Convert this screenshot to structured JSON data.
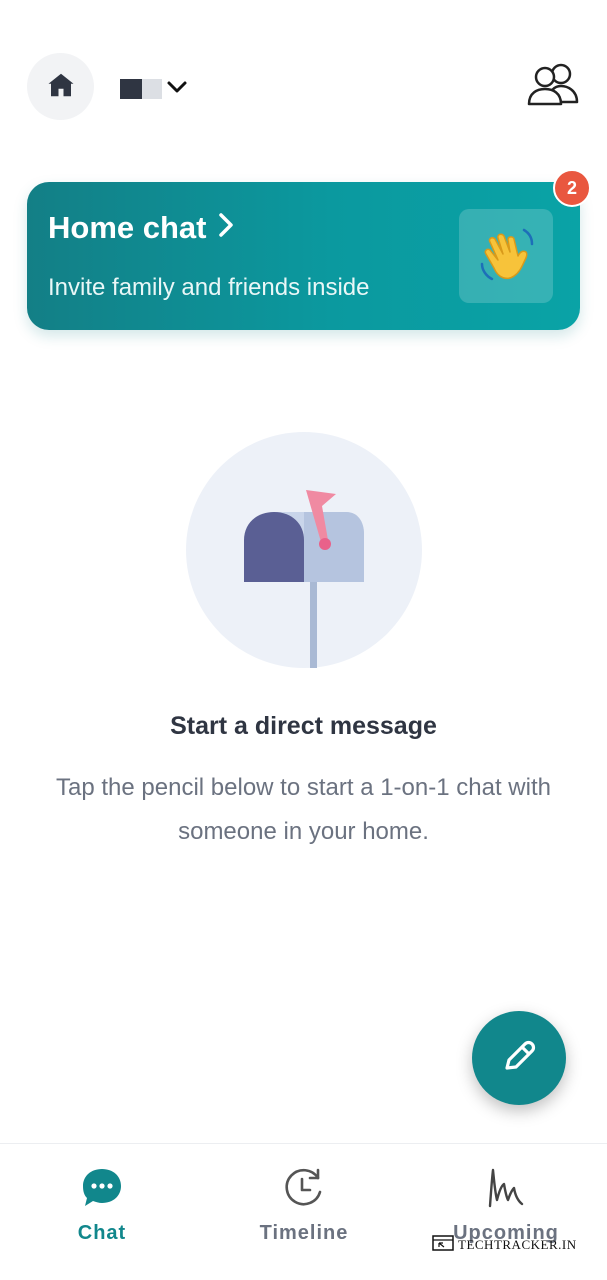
{
  "header": {
    "home_icon": "house-icon",
    "home_selector_icon": "chevron-down-icon",
    "members_icon": "people-icon"
  },
  "home_chat_card": {
    "title": "Home chat",
    "subtitle": "Invite family and friends inside",
    "icon": "waving-hand-icon",
    "badge_count": "2",
    "colors": {
      "start": "#137f86",
      "end": "#0aa3a6",
      "badge": "#e9573f"
    }
  },
  "empty_state": {
    "illustration": "mailbox-icon",
    "title": "Start a direct message",
    "body": "Tap the pencil below to start a 1-on-1 chat with someone in your home."
  },
  "fab": {
    "icon": "pencil-icon",
    "color": "#11878c"
  },
  "tabs": [
    {
      "label": "Chat",
      "icon": "chat-bubble-icon",
      "active": true
    },
    {
      "label": "Timeline",
      "icon": "clock-history-icon",
      "active": false
    },
    {
      "label": "Upcoming",
      "icon": "signature-icon",
      "active": false
    }
  ],
  "watermark": {
    "text": "TECHTRACKER.IN"
  },
  "colors": {
    "accent": "#11878c",
    "text_dark": "#2f3542",
    "text_muted": "#6b7280"
  }
}
